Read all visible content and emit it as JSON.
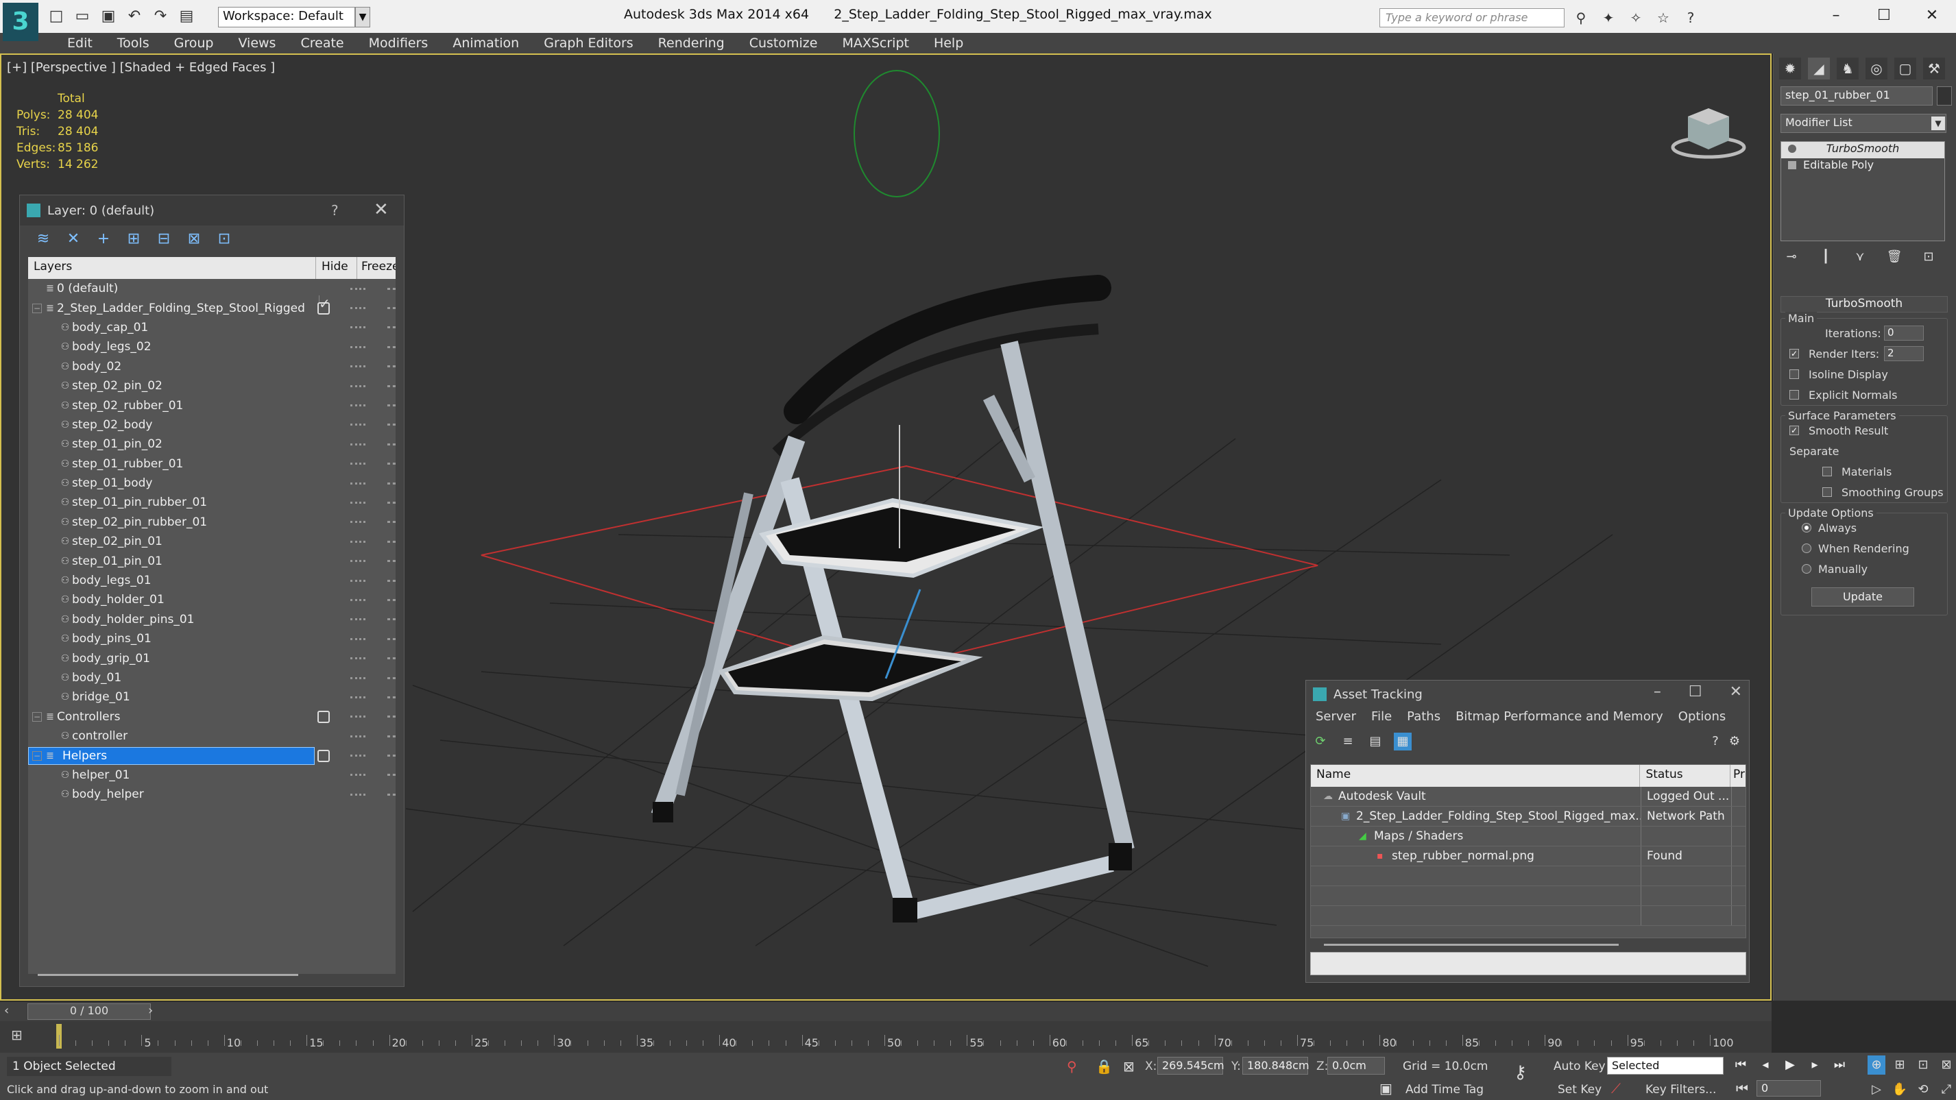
{
  "titlebar": {
    "workspace": "Workspace: Default",
    "app": "Autodesk 3ds Max  2014 x64",
    "file": "2_Step_Ladder_Folding_Step_Stool_Rigged_max_vray.max",
    "search_placeholder": "Type a keyword or phrase",
    "logo": "3"
  },
  "menu": [
    "Edit",
    "Tools",
    "Group",
    "Views",
    "Create",
    "Modifiers",
    "Animation",
    "Graph Editors",
    "Rendering",
    "Customize",
    "MAXScript",
    "Help"
  ],
  "viewport": {
    "label": "[+] [Perspective ] [Shaded + Edged Faces ]",
    "stats": {
      "header": "Total",
      "rows": [
        {
          "k": "Polys:",
          "v": "28 404"
        },
        {
          "k": "Tris:",
          "v": "28 404"
        },
        {
          "k": "Edges:",
          "v": "85 186"
        },
        {
          "k": "Verts:",
          "v": "14 262"
        }
      ]
    }
  },
  "layers": {
    "title": "Layer: 0 (default)",
    "help": "?",
    "close": "✕",
    "columns": {
      "layers": "Layers",
      "hide": "Hide",
      "freeze": "Freeze"
    },
    "rows": [
      {
        "name": "0 (default)",
        "level": 0,
        "type": "layer",
        "active": true
      },
      {
        "name": "2_Step_Ladder_Folding_Step_Stool_Rigged",
        "level": 0,
        "type": "layer",
        "expand": true
      },
      {
        "name": "body_cap_01",
        "level": 1,
        "type": "object"
      },
      {
        "name": "body_legs_02",
        "level": 1,
        "type": "object"
      },
      {
        "name": "body_02",
        "level": 1,
        "type": "object"
      },
      {
        "name": "step_02_pin_02",
        "level": 1,
        "type": "object"
      },
      {
        "name": "step_02_rubber_01",
        "level": 1,
        "type": "object"
      },
      {
        "name": "step_02_body",
        "level": 1,
        "type": "object"
      },
      {
        "name": "step_01_pin_02",
        "level": 1,
        "type": "object"
      },
      {
        "name": "step_01_rubber_01",
        "level": 1,
        "type": "object"
      },
      {
        "name": "step_01_body",
        "level": 1,
        "type": "object"
      },
      {
        "name": "step_01_pin_rubber_01",
        "level": 1,
        "type": "object"
      },
      {
        "name": "step_02_pin_rubber_01",
        "level": 1,
        "type": "object"
      },
      {
        "name": "step_02_pin_01",
        "level": 1,
        "type": "object"
      },
      {
        "name": "step_01_pin_01",
        "level": 1,
        "type": "object"
      },
      {
        "name": "body_legs_01",
        "level": 1,
        "type": "object"
      },
      {
        "name": "body_holder_01",
        "level": 1,
        "type": "object"
      },
      {
        "name": "body_holder_pins_01",
        "level": 1,
        "type": "object"
      },
      {
        "name": "body_pins_01",
        "level": 1,
        "type": "object"
      },
      {
        "name": "body_grip_01",
        "level": 1,
        "type": "object"
      },
      {
        "name": "body_01",
        "level": 1,
        "type": "object"
      },
      {
        "name": "bridge_01",
        "level": 1,
        "type": "object"
      },
      {
        "name": "Controllers",
        "level": 0,
        "type": "layer",
        "expand": true
      },
      {
        "name": "controller",
        "level": 1,
        "type": "object"
      },
      {
        "name": "Helpers",
        "level": 0,
        "type": "layer",
        "expand": true,
        "selected": true
      },
      {
        "name": "helper_01",
        "level": 1,
        "type": "object"
      },
      {
        "name": "body_helper",
        "level": 1,
        "type": "object"
      }
    ]
  },
  "asset": {
    "title": "Asset Tracking",
    "menu": [
      "Server",
      "File",
      "Paths",
      "Bitmap Performance and Memory",
      "Options"
    ],
    "columns": {
      "name": "Name",
      "status": "Status",
      "p": "Pr"
    },
    "rows": [
      {
        "name": "Autodesk Vault",
        "status": "Logged Out ...",
        "indent": 0
      },
      {
        "name": "2_Step_Ladder_Folding_Step_Stool_Rigged_max...",
        "status": "Network Path",
        "indent": 1
      },
      {
        "name": "Maps / Shaders",
        "status": "",
        "indent": 2
      },
      {
        "name": "step_rubber_normal.png",
        "status": "Found",
        "indent": 3
      }
    ]
  },
  "cmd": {
    "object_name": "step_01_rubber_01",
    "modifier_list": "Modifier List",
    "stack": [
      "TurboSmooth",
      "Editable Poly"
    ],
    "rollout": "TurboSmooth",
    "main": "Main",
    "iterations_label": "Iterations:",
    "iterations": "0",
    "render_iters_label": "Render Iters:",
    "render_iters": "2",
    "isoline": "Isoline Display",
    "explicit": "Explicit Normals",
    "surface": "Surface Parameters",
    "smooth": "Smooth Result",
    "separate": "Separate",
    "materials": "Materials",
    "smoothing": "Smoothing Groups",
    "update_options": "Update Options",
    "always": "Always",
    "when_rendering": "When Rendering",
    "manually": "Manually",
    "update": "Update"
  },
  "timeline": {
    "frame": "0 / 100",
    "ticks": [
      "5",
      "10",
      "15",
      "20",
      "25",
      "30",
      "35",
      "40",
      "45",
      "50",
      "55",
      "60",
      "65",
      "70",
      "75",
      "80",
      "85",
      "90",
      "95",
      "100"
    ]
  },
  "status": {
    "selected": "1 Object Selected",
    "prompt": "Click and drag up-and-down to zoom in and out",
    "x_label": "X:",
    "x": "269.545cm",
    "y_label": "Y:",
    "y": "180.848cm",
    "z_label": "Z:",
    "z": "0.0cm",
    "grid": "Grid = 10.0cm",
    "add_time_tag": "Add Time Tag",
    "auto_key": "Auto Key",
    "set_key": "Set Key",
    "selected_mode": "Selected",
    "key_filters": "Key Filters...",
    "frame": "0"
  }
}
